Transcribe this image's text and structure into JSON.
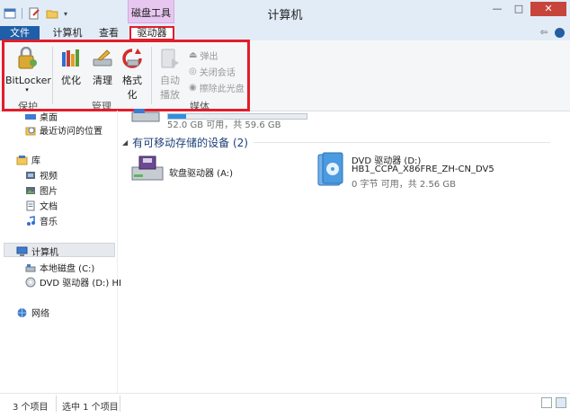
{
  "window": {
    "title": "计算机",
    "context_group": "磁盘工具",
    "controls": {
      "minimize": "—",
      "maximize": "□",
      "close": "✕"
    }
  },
  "tabs": {
    "file": "文件",
    "computer": "计算机",
    "view": "查看",
    "drive_tools": "驱动器",
    "help": "?"
  },
  "ribbon": {
    "bitlocker": "BitLocker",
    "optimize": "优化",
    "cleanup": "清理",
    "format_line1": "格式",
    "format_line2": "化",
    "autoplay_line1": "自动",
    "autoplay_line2": "播放",
    "eject": "弹出",
    "close_session": "关闭会话",
    "erase_disc": "擦除此光盘",
    "group_protect": "保护",
    "group_manage": "管理",
    "group_media": "媒体"
  },
  "nav": {
    "desktop": "桌面",
    "recent": "最近访问的位置",
    "libraries": "库",
    "videos": "视频",
    "pictures": "图片",
    "documents": "文档",
    "music": "音乐",
    "computer": "计算机",
    "local_disk": "本地磁盘 (C:)",
    "dvd_drive": "DVD 驱动器 (D:) HI",
    "network": "网络"
  },
  "content": {
    "c_drive_space": "52.0 GB 可用，共 59.6 GB",
    "removable_header": "有可移动存储的设备 (2)",
    "floppy": "软盘驱动器 (A:)",
    "dvd_name": "DVD 驱动器 (D:)",
    "dvd_label": "HB1_CCPA_X86FRE_ZH-CN_DV5",
    "dvd_space": "0 字节 可用，共 2.56 GB"
  },
  "status": {
    "count": "3 个项目",
    "selected": "选中 1 个项目"
  },
  "colors": {
    "accent": "#1f5ea8",
    "highlight": "#e21d2b",
    "context_tab": "#e7c7ef"
  }
}
